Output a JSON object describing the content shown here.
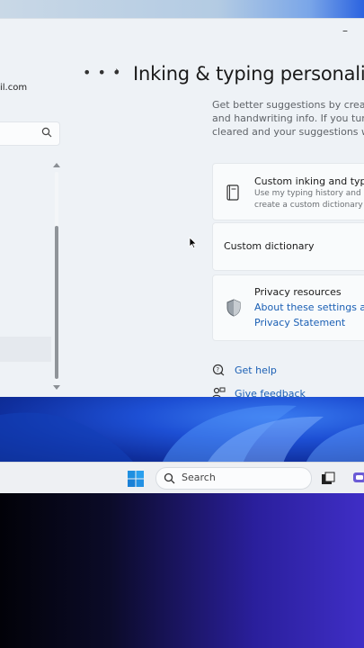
{
  "window": {
    "minimize_glyph": "–",
    "account_email": "il.com",
    "search_placeholder": "",
    "breadcrumb_more": "• • •",
    "breadcrumb_separator": "›",
    "page_title": "Inking & typing personaliz"
  },
  "intro": {
    "lines": [
      "Get better suggestions by creating",
      "and handwriting info. If you turn o",
      "cleared and your suggestions won"
    ]
  },
  "cards": {
    "custom": {
      "icon": "book-icon",
      "title": "Custom inking and typing",
      "desc_line1": "Use my typing history and h",
      "desc_line2": "create a custom dictionary"
    },
    "dictionary": {
      "title": "Custom dictionary"
    },
    "privacy": {
      "icon": "shield-icon",
      "title": "Privacy resources",
      "link1": "About these settings and",
      "link2": "Privacy Statement"
    }
  },
  "footer": {
    "help": "Get help",
    "feedback": "Give feedback"
  },
  "taskbar": {
    "search_label": "Search"
  },
  "colors": {
    "accent_link": "#1a5fb4",
    "window_bg": "#eef2f6",
    "taskbar_bg": "#eef0f3"
  }
}
